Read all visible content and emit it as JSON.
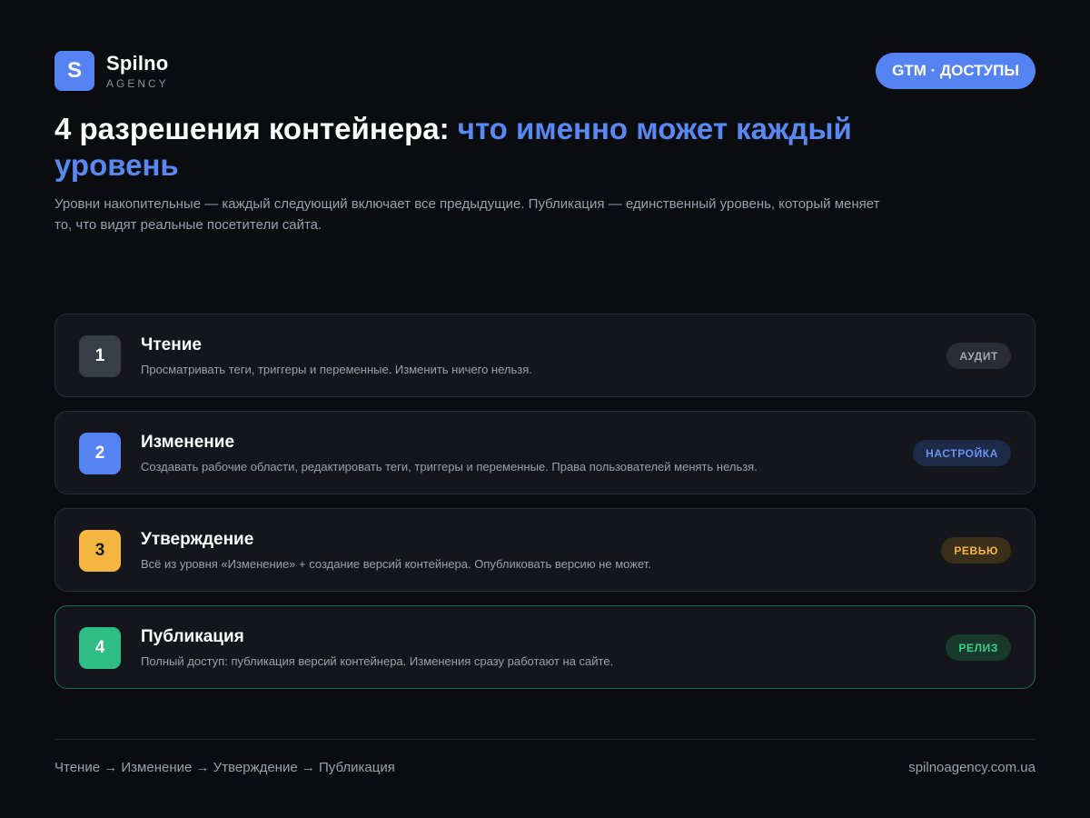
{
  "brand": {
    "logo_letter": "S",
    "name": "Spilno",
    "sub": "AGENCY"
  },
  "header_badge": "GTM · ДОСТУПЫ",
  "title": {
    "main": "4 разрешения контейнера: ",
    "accent": "что именно может каждый уровень"
  },
  "subtitle": "Уровни накопительные — каждый следующий включает все предыдущие. Публикация — единственный уровень, который меняет то, что видят реальные посетители сайта.",
  "levels": [
    {
      "number": "1",
      "title": "Чтение",
      "description": "Просматривать теги, триггеры и переменные. Изменить ничего нельзя.",
      "tag": "АУДИТ",
      "number_bg": "#3a3e46",
      "number_color": "#ffffff",
      "tag_bg": "#2a2d33",
      "tag_color": "#a3a7b0"
    },
    {
      "number": "2",
      "title": "Изменение",
      "description": "Создавать рабочие области, редактировать теги, триггеры и переменные. Права пользователей менять нельзя.",
      "tag": "НАСТРОЙКА",
      "number_bg": "#5584f2",
      "number_color": "#ffffff",
      "tag_bg": "#1d2a48",
      "tag_color": "#6b93f4"
    },
    {
      "number": "3",
      "title": "Утверждение",
      "description": "Всё из уровня «Изменение» + создание версий контейнера. Опубликовать версию не может.",
      "tag": "РЕВЬЮ",
      "number_bg": "#f4b63f",
      "number_color": "#1a1a1a",
      "tag_bg": "#3a2f18",
      "tag_color": "#f4b63f"
    },
    {
      "number": "4",
      "title": "Публикация",
      "description": "Полный доступ: публикация версий контейнера. Изменения сразу работают на сайте.",
      "tag": "РЕЛИЗ",
      "number_bg": "#2ebd85",
      "number_color": "#ffffff",
      "tag_bg": "#173a2c",
      "tag_color": "#3ccf8e"
    }
  ],
  "footer": {
    "chain": "Чтение → Изменение → Утверждение → Публикация",
    "site": "spilnoagency.com.ua"
  },
  "colors": {
    "background": "#0b0c10",
    "accent": "#5584f2"
  }
}
